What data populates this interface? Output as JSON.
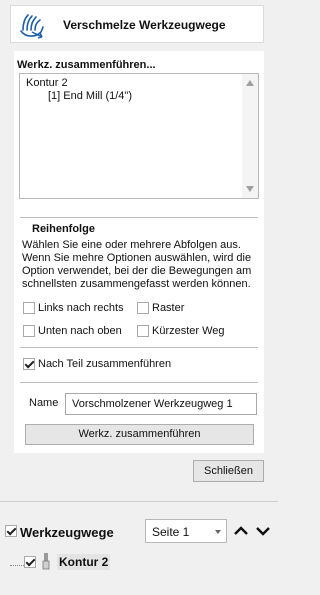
{
  "header": {
    "title": "Verschmelze Werkzeugwege",
    "icon": "merge-hand-icon"
  },
  "toolpaths_list": {
    "title": "Werkz. zusammenführen...",
    "items": [
      "Kontur 2",
      "[1] End Mill (1/4\")"
    ]
  },
  "order": {
    "title": "Reihenfolge",
    "description": "Wählen Sie eine oder mehrere Abfolgen aus. Wenn Sie mehre Optionen auswählen, wird die Option verwendet, bei der die Bewegungen am schnellsten zusammengefasst werden können.",
    "options": [
      {
        "label": "Links nach rechts",
        "checked": false
      },
      {
        "label": "Raster",
        "checked": false
      },
      {
        "label": "Unten nach oben",
        "checked": false
      },
      {
        "label": "Kürzester Weg",
        "checked": false
      }
    ]
  },
  "merge_by_part": {
    "label": "Nach Teil zusammenführen",
    "checked": true
  },
  "name_field": {
    "label": "Name",
    "value": "Vorschmolzener Werkzeugweg 1"
  },
  "merge_button": "Werkz. zusammenführen",
  "close_button": "Schließen",
  "toolpaths_panel": {
    "title": "Werkzeugwege",
    "checked": true,
    "page_select": "Seite 1",
    "tree": [
      {
        "label": "Kontur 2",
        "checked": true
      }
    ]
  },
  "colors": {
    "accent": "#1a5fa8",
    "panel_bg": "#ffffff",
    "window_bg": "#f0f0f0"
  }
}
